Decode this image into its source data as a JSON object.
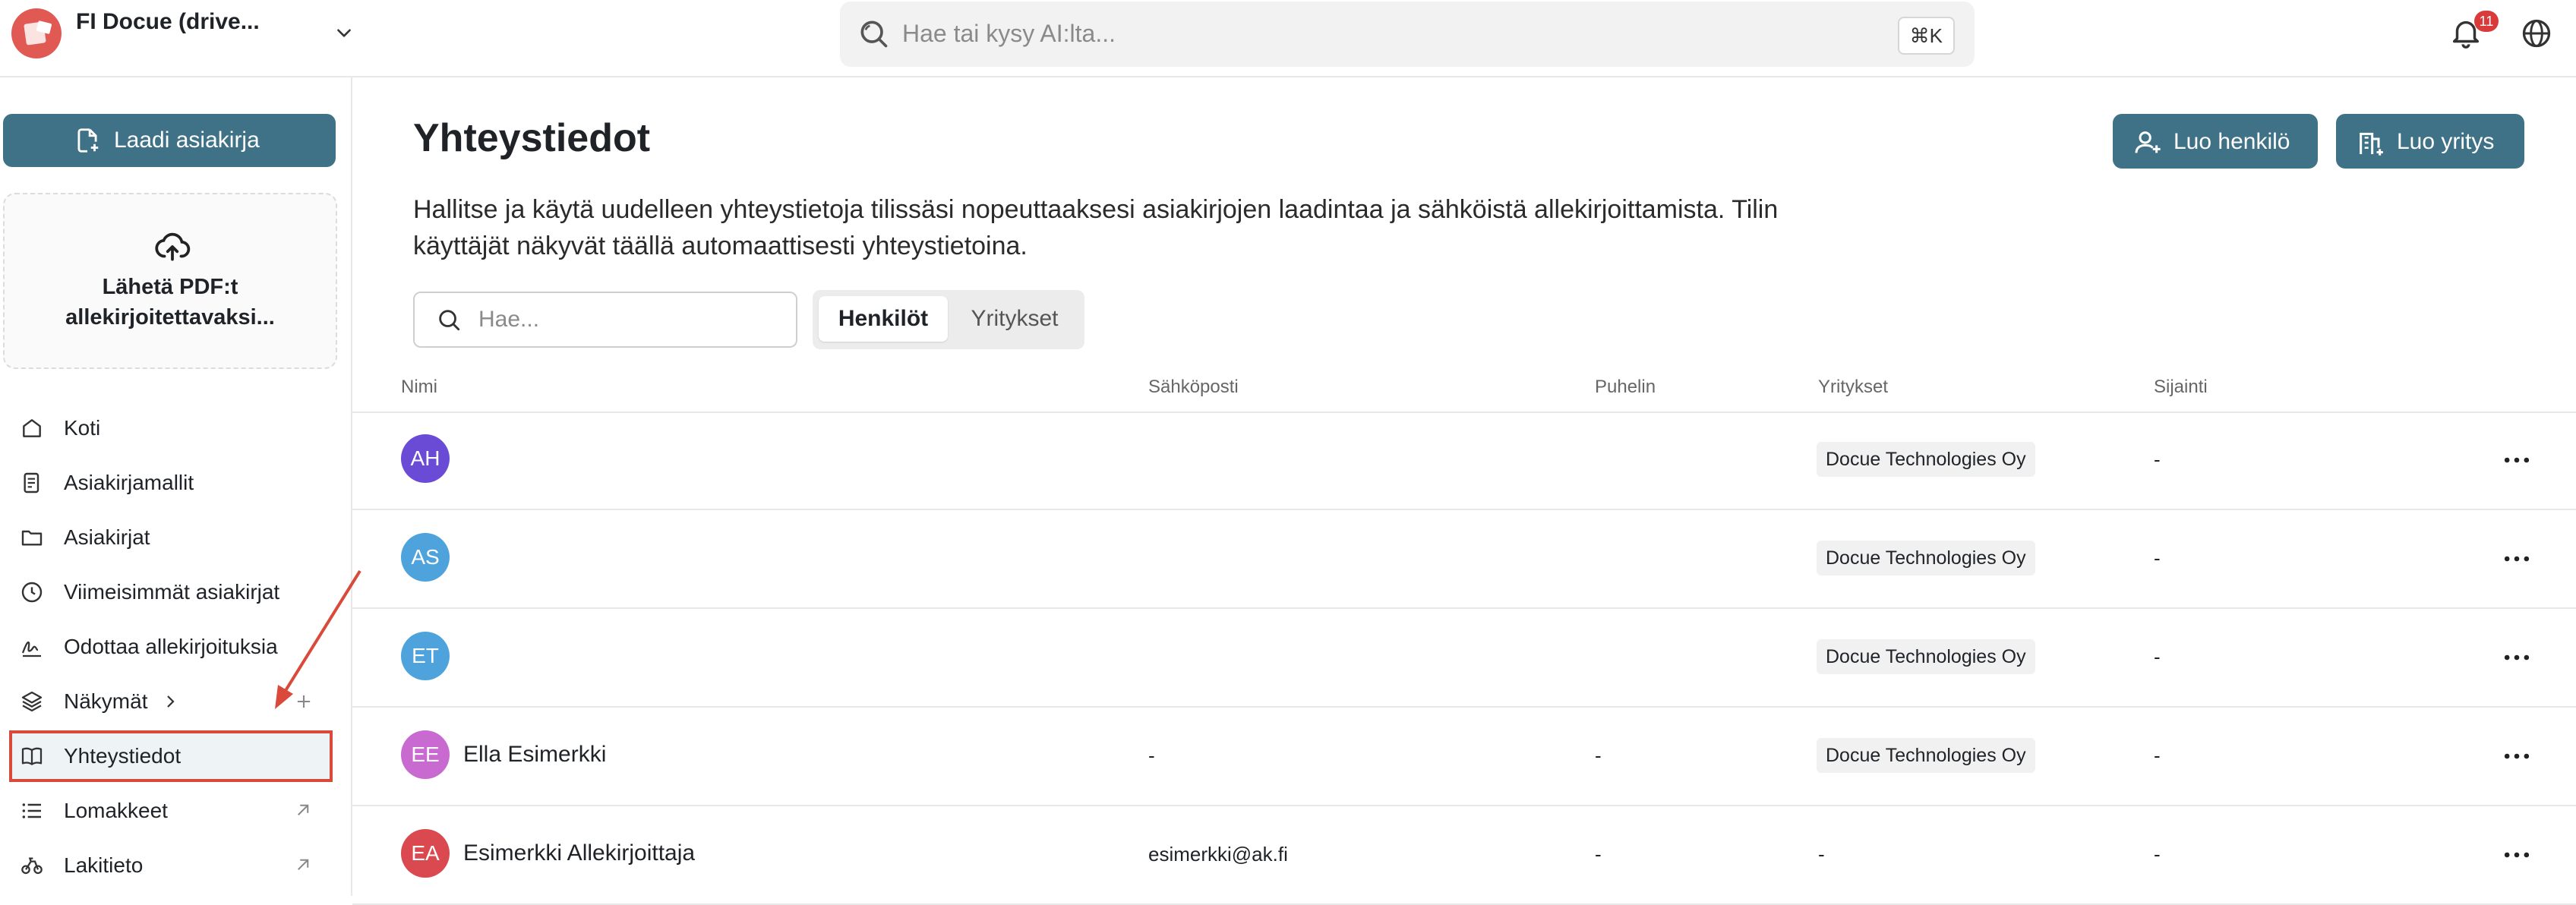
{
  "workspace": {
    "name": "FI Docue (drive..."
  },
  "search": {
    "placeholder": "Hae tai kysy AI:lta...",
    "shortcut": "⌘K"
  },
  "notifications": {
    "count": "11"
  },
  "sidebar": {
    "create_label": "Laadi asiakirja",
    "upload_label": "Lähetä PDF:t allekirjoitettavaksi...",
    "items": [
      {
        "label": "Koti",
        "icon": "home-icon"
      },
      {
        "label": "Asiakirjamallit",
        "icon": "template-icon"
      },
      {
        "label": "Asiakirjat",
        "icon": "folder-icon"
      },
      {
        "label": "Viimeisimmät asiakirjat",
        "icon": "clock-icon"
      },
      {
        "label": "Odottaa allekirjoituksia",
        "icon": "signature-icon"
      },
      {
        "label": "Näkymät",
        "icon": "layers-icon"
      },
      {
        "label": "Yhteystiedot",
        "icon": "book-icon"
      },
      {
        "label": "Lomakkeet",
        "icon": "list-icon"
      },
      {
        "label": "Lakitieto",
        "icon": "scale-icon"
      }
    ]
  },
  "page": {
    "title": "Yhteystiedot",
    "create_person_label": "Luo henkilö",
    "create_company_label": "Luo yritys",
    "description": "Hallitse ja käytä uudelleen yhteystietoja tilissäsi nopeuttaaksesi asiakirjojen laadintaa ja sähköistä allekirjoittamista. Tilin käyttäjät näkyvät täällä automaattisesti yhteystietoina.",
    "search_placeholder": "Hae...",
    "tabs": [
      "Henkilöt",
      "Yritykset"
    ]
  },
  "table": {
    "headers": [
      "Nimi",
      "Sähköposti",
      "Puhelin",
      "Yritykset",
      "Sijainti"
    ],
    "rows": [
      {
        "initials": "AH",
        "color": "#6a4bd6",
        "name": "",
        "email": "",
        "phone": "",
        "company": "Docue Technologies Oy",
        "location": "-"
      },
      {
        "initials": "AS",
        "color": "#4ea3dc",
        "name": "",
        "email": "",
        "phone": "",
        "company": "Docue Technologies Oy",
        "location": "-"
      },
      {
        "initials": "ET",
        "color": "#4ea3dc",
        "name": "",
        "email": "",
        "phone": "",
        "company": "Docue Technologies Oy",
        "location": "-"
      },
      {
        "initials": "EE",
        "color": "#c86ad0",
        "name": "Ella Esimerkki",
        "email": "-",
        "phone": "-",
        "company": "Docue Technologies Oy",
        "location": "-"
      },
      {
        "initials": "EA",
        "color": "#d9494f",
        "name": "Esimerkki Allekirjoittaja",
        "email": "esimerkki@ak.fi",
        "phone": "-",
        "company": "-",
        "location": "-"
      }
    ]
  },
  "colors": {
    "accent": "#3f7287",
    "highlight": "#d94a3a"
  }
}
